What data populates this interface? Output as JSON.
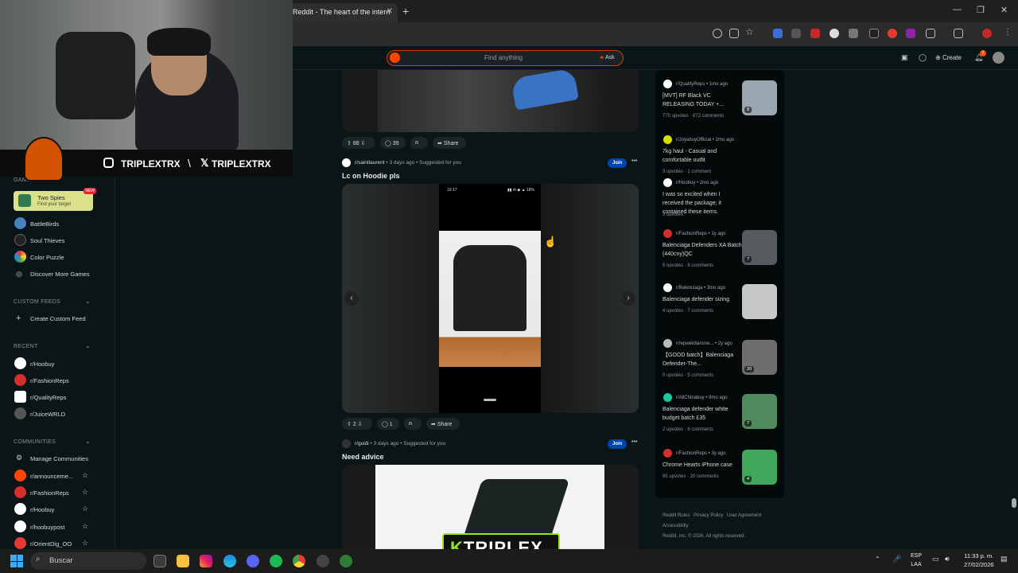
{
  "browser": {
    "tab_title": "Reddit - The heart of the intern",
    "tab_close": "✕",
    "new_tab": "+",
    "window_controls": [
      "—",
      "❐",
      "✕"
    ]
  },
  "header": {
    "search_placeholder": "Find anything",
    "ask_label": "Ask",
    "create_label": "Create",
    "notification_count": "2"
  },
  "stream": {
    "instagram_handle": "TRIPLEXTRX",
    "x_handle": "TRIPLEXTRX",
    "separator": "\\",
    "logo_k": "K",
    "logo_text": "TRIPLEX"
  },
  "sidebar": {
    "games_label": "GAMES O",
    "featured_game": {
      "title": "Two Spies",
      "subtitle": "Find your target",
      "badge": "NEW"
    },
    "games": [
      "BattleBirds",
      "Soul Thieves",
      "Color Puzzle",
      "Discover More Games"
    ],
    "custom_feeds_label": "CUSTOM FEEDS",
    "create_custom_feed": "Create Custom Feed",
    "recent_label": "RECENT",
    "recent": [
      "r/Hoobuy",
      "r/FashionReps",
      "r/QualityReps",
      "r/JuiceWRLD"
    ],
    "communities_label": "COMMUNITIES",
    "manage_communities": "Manage Communities",
    "communities": [
      "r/announceme...",
      "r/FashionReps",
      "r/Hoobuy",
      "r/hoobuypost",
      "r/OrientDig_OO"
    ]
  },
  "feed": {
    "post0": {
      "upvotes": "88",
      "comments": "39",
      "share": "Share"
    },
    "post1": {
      "subreddit": "r/saintlaurent",
      "meta": " • 3 days ago • Suggested for you",
      "join": "Join",
      "more": "•••",
      "title": "Lc on Hoodie pls",
      "phone_time": "19:17",
      "phone_status": "▮▮ ✉ ◆ ▲ 18%",
      "upvotes": "2",
      "comments": "1",
      "share": "Share"
    },
    "post2": {
      "subreddit": "r/guidi",
      "meta": " • 3 days ago • Suggested for you",
      "join": "Join",
      "more": "•••",
      "title": "Need advice"
    }
  },
  "right_panel": {
    "items": [
      {
        "sub": "r/QualityReps • 1mo ago",
        "title": "[MVT] RF Black VC RELEASING TODAY +...",
        "stats": "770 upvotes · 872 comments",
        "thumb_count": "8",
        "icon_color": "#ffffff",
        "thumb_color": "#9aa7b0"
      },
      {
        "sub": "r/JoyabuyOfficial • 2mo ago",
        "title": "7kg haul - Casual and comfortable outfit",
        "stats": "3 upvotes · 1 comment",
        "icon_color": "#d4e000"
      },
      {
        "sub": "r/Hoobuy • 2mo ago",
        "title": "I was so excited when I received the package; it contained these items.",
        "stats": "3 upvotes",
        "icon_color": "#ffffff"
      },
      {
        "sub": "r/FashionReps • 1y ago",
        "title": "Balenciaga Defenders XA Batch (440cny)QC",
        "stats": "5 upvotes · 8 comments",
        "thumb_count": "7",
        "icon_color": "#d32f2f",
        "thumb_color": "#555a5e"
      },
      {
        "sub": "r/Balenciaga • 3mo ago",
        "title": "Balenciaga defender sizing",
        "stats": "4 upvotes · 7 comments",
        "icon_color": "#ffffff",
        "thumb_color": "#c7c9c9"
      },
      {
        "sub": "r/repweidiansne... • 2y ago",
        "title": "【GOOD batch】Balenciaga Defender-The...",
        "stats": "0 upvotes · 5 comments",
        "thumb_count": "20",
        "icon_color": "#bbbbbb",
        "thumb_color": "#6e6d70"
      },
      {
        "sub": "r/AllChinabuy • 9mo ago",
        "title": "Balenciaga defender white budget batch £35",
        "stats": "2 upvotes · 6 comments",
        "thumb_count": "7",
        "icon_color": "#1ec8a0",
        "thumb_color": "#4f8a5c"
      },
      {
        "sub": "r/FashionReps • 3y ago",
        "title": "Chrome Hearts iPhone case",
        "stats": "85 upvotes · 20 comments",
        "thumb_count": "4",
        "icon_color": "#d32f2f",
        "thumb_color": "#3fa85a"
      }
    ],
    "footer": [
      "Reddit Rules",
      "Privacy Policy",
      "User Agreement",
      "Accessibility"
    ],
    "copyright": "Reddit, Inc. © 2026. All rights reserved."
  },
  "taskbar": {
    "search_label": "Buscar",
    "lang_line1": "ESP",
    "lang_line2": "LAA",
    "time": "11:33 p. m.",
    "date": "27/02/2026"
  },
  "colors": {
    "reddit_orange": "#ff4500",
    "join_blue": "#0045ac",
    "logo_green": "#9be51c"
  }
}
